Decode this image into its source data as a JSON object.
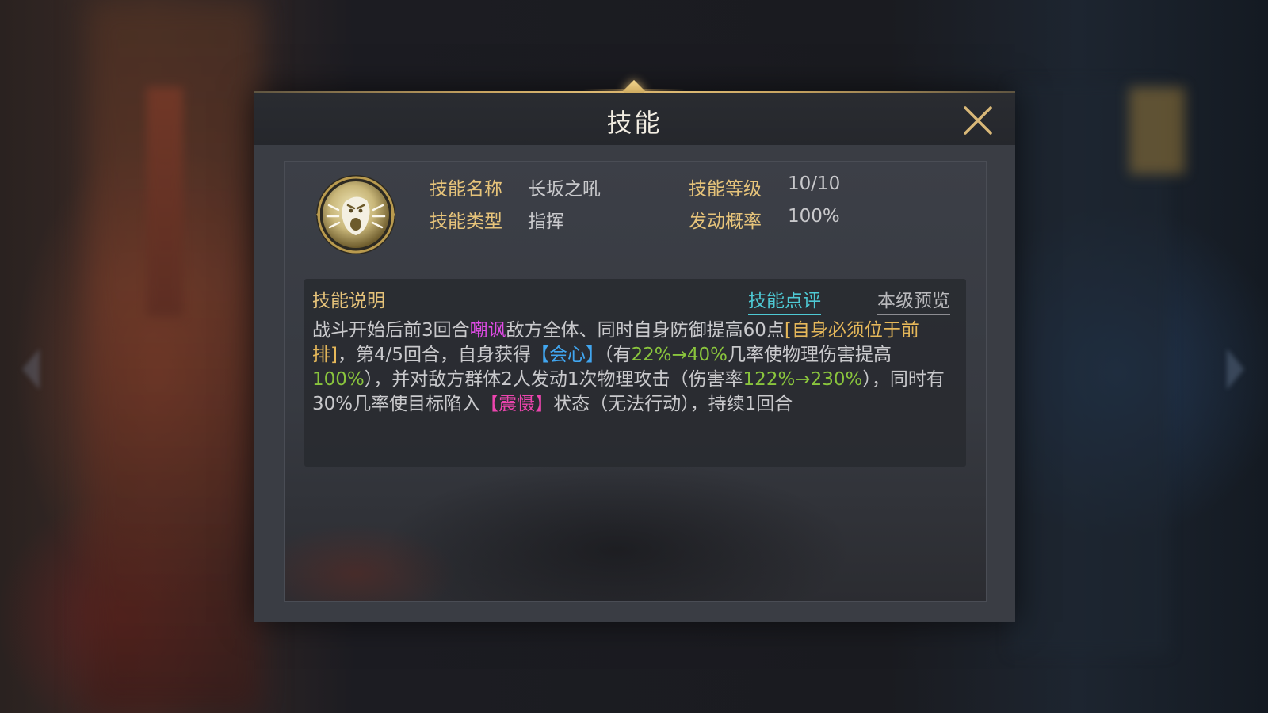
{
  "dialog": {
    "title": "技能"
  },
  "skill": {
    "icon": "roaring-face-icon",
    "name_label": "技能名称",
    "name_value": "长坂之吼",
    "level_label": "技能等级",
    "level_value": "10/10",
    "type_label": "技能类型",
    "type_value": "指挥",
    "chance_label": "发动概率",
    "chance_value": "100%"
  },
  "description": {
    "title": "技能说明",
    "review_link": "技能点评",
    "preview_link": "本级预览",
    "segments": {
      "s1": "战斗开始后前3回合",
      "s2": "嘲讽",
      "s3": "敌方全体、同时自身防御提高60点",
      "s4": "[自身必须位于前排]",
      "s5": "，第4/5回合，自身获得",
      "s6": "【会心】",
      "s7": "（有",
      "s8": "22%→40%",
      "s9": "几率使物理伤害提高",
      "s10": "100%",
      "s11": "），并对敌方群体2人发动1次物理攻击（伤害率",
      "s12": "122%→230%",
      "s13": "），同时有30%几率使目标陷入",
      "s14": "【震慑】",
      "s15": "状态（无法行动），持续1回合"
    }
  },
  "colors": {
    "accent_gold": "#e6c37a",
    "link_cyan": "#4ec9d4",
    "taunt_magenta": "#e04be6",
    "crit_blue": "#41a6f0",
    "value_green": "#8ac53d",
    "stun_pink": "#ec45ae"
  }
}
